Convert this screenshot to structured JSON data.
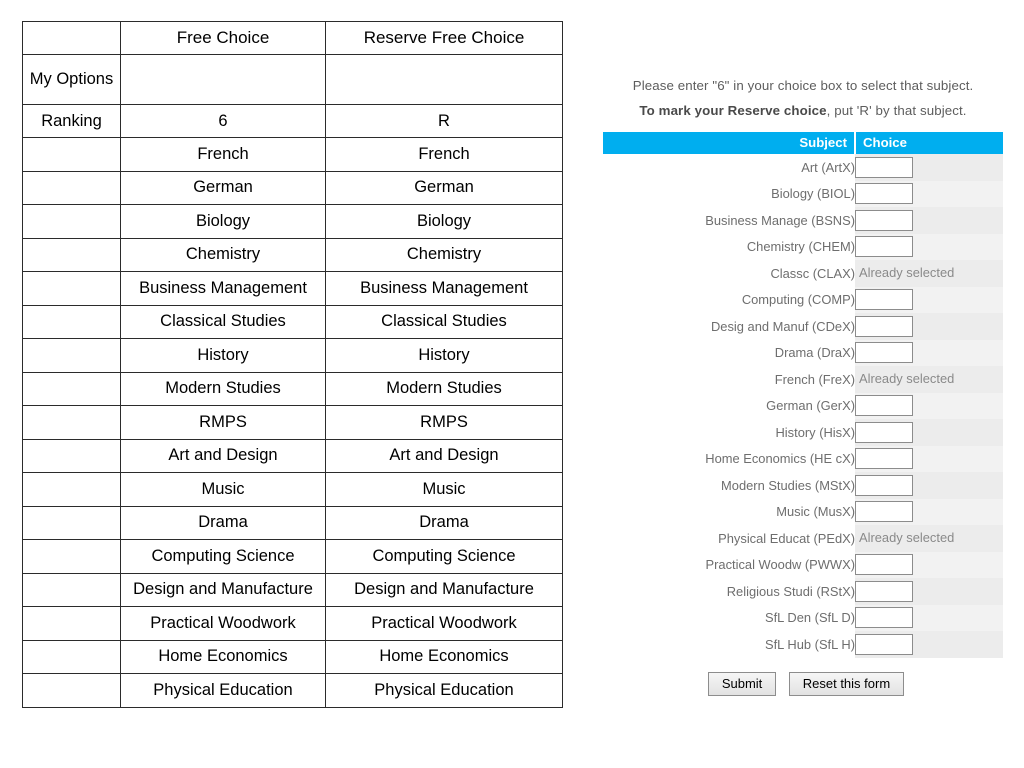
{
  "options_table": {
    "columns": {
      "label": "",
      "free_choice": "Free Choice",
      "reserve_free_choice": "Reserve Free Choice"
    },
    "row_labels": {
      "my_options": "My Options",
      "ranking": "Ranking"
    },
    "ranking": {
      "free_choice": "6",
      "reserve_free_choice": "R"
    },
    "rows": [
      {
        "free": "French",
        "reserve": "French"
      },
      {
        "free": "German",
        "reserve": "German"
      },
      {
        "free": "Biology",
        "reserve": "Biology"
      },
      {
        "free": "Chemistry",
        "reserve": "Chemistry"
      },
      {
        "free": "Business Management",
        "reserve": "Business Management"
      },
      {
        "free": "Classical Studies",
        "reserve": "Classical Studies"
      },
      {
        "free": "History",
        "reserve": "History"
      },
      {
        "free": "Modern Studies",
        "reserve": "Modern Studies"
      },
      {
        "free": "RMPS",
        "reserve": "RMPS"
      },
      {
        "free": "Art and Design",
        "reserve": "Art and Design"
      },
      {
        "free": "Music",
        "reserve": "Music"
      },
      {
        "free": "Drama",
        "reserve": "Drama"
      },
      {
        "free": "Computing Science",
        "reserve": "Computing Science"
      },
      {
        "free": "Design and Manufacture",
        "reserve": "Design and Manufacture"
      },
      {
        "free": "Practical Woodwork",
        "reserve": "Practical Woodwork"
      },
      {
        "free": "Home Economics",
        "reserve": "Home Economics"
      },
      {
        "free": "Physical Education",
        "reserve": "Physical Education"
      }
    ]
  },
  "form": {
    "instruction_1": "Please enter \"6\" in your choice box to select that subject.",
    "instruction_2_bold": "To mark your Reserve choice",
    "instruction_2_rest": ", put 'R' by that subject.",
    "header_subject": "Subject",
    "header_choice": "Choice",
    "header_color": "#00AEEF",
    "already_selected_label": "Already selected",
    "choice_value": "",
    "subjects": [
      {
        "label": "Art (ArtX)",
        "state": "input",
        "value": ""
      },
      {
        "label": "Biology (BIOL)",
        "state": "input",
        "value": ""
      },
      {
        "label": "Business Manage (BSNS)",
        "state": "input",
        "value": ""
      },
      {
        "label": "Chemistry (CHEM)",
        "state": "input",
        "value": ""
      },
      {
        "label": "Classc (CLAX)",
        "state": "already_selected",
        "value": "Already selected"
      },
      {
        "label": "Computing (COMP)",
        "state": "input",
        "value": ""
      },
      {
        "label": "Desig and Manuf (CDeX)",
        "state": "input",
        "value": ""
      },
      {
        "label": "Drama (DraX)",
        "state": "input",
        "value": ""
      },
      {
        "label": "French (FreX)",
        "state": "already_selected",
        "value": "Already selected"
      },
      {
        "label": "German (GerX)",
        "state": "input",
        "value": ""
      },
      {
        "label": "History (HisX)",
        "state": "input",
        "value": ""
      },
      {
        "label": "Home Economics (HE cX)",
        "state": "input",
        "value": ""
      },
      {
        "label": "Modern Studies (MStX)",
        "state": "input",
        "value": ""
      },
      {
        "label": "Music (MusX)",
        "state": "input",
        "value": ""
      },
      {
        "label": "Physical Educat (PEdX)",
        "state": "already_selected",
        "value": "Already selected"
      },
      {
        "label": "Practical Woodw (PWWX)",
        "state": "input",
        "value": ""
      },
      {
        "label": "Religious Studi (RStX)",
        "state": "input",
        "value": ""
      },
      {
        "label": "SfL Den (SfL D)",
        "state": "input",
        "value": ""
      },
      {
        "label": "SfL Hub (SfL H)",
        "state": "input",
        "value": ""
      }
    ],
    "submit_label": "Submit",
    "reset_label": "Reset this form"
  }
}
